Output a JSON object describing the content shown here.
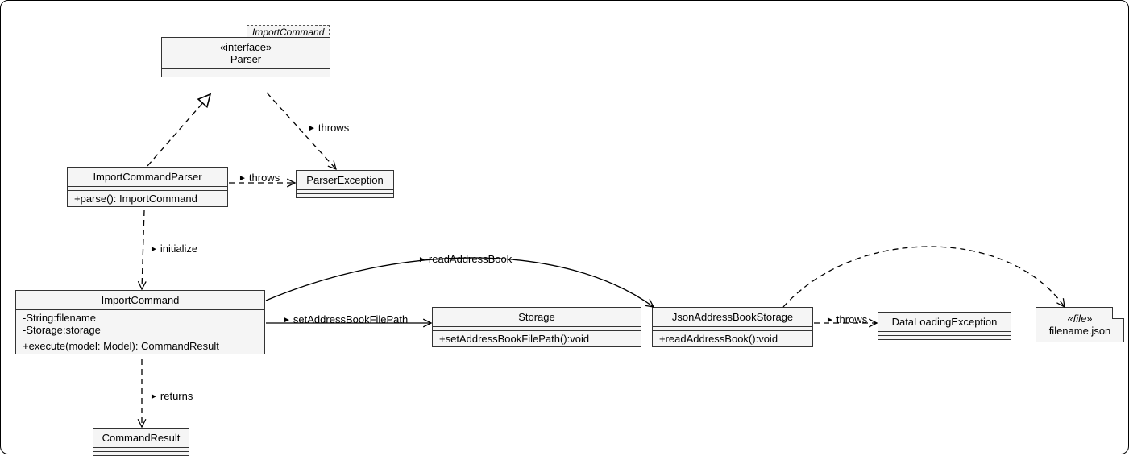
{
  "package_tab": "ImportCommand",
  "parser_interface": {
    "stereotype": "«interface»",
    "name": "Parser"
  },
  "import_command_parser": {
    "name": "ImportCommandParser",
    "method": "+parse(): ImportCommand"
  },
  "parser_exception": {
    "name": "ParserException"
  },
  "import_command": {
    "name": "ImportCommand",
    "attr1": "-String:filename",
    "attr2": "-Storage:storage",
    "method": "+execute(model: Model): CommandResult"
  },
  "storage": {
    "name": "Storage",
    "method": "+setAddressBookFilePath():void"
  },
  "json_storage": {
    "name": "JsonAddressBookStorage",
    "method": "+readAddressBook():void"
  },
  "data_loading_exception": {
    "name": "DataLoadingException"
  },
  "command_result": {
    "name": "CommandResult"
  },
  "file_note": {
    "stereotype": "«file»",
    "name": "filename.json"
  },
  "labels": {
    "throws_parser_interface": "throws",
    "throws_icp": "throws",
    "initialize": "initialize",
    "setAddressBookFilePath": "setAddressBookFilePath",
    "readAddressBook": "readAddressBook",
    "throws_json": "throws",
    "returns": "returns"
  },
  "chart_data": {
    "type": "uml-class-diagram",
    "package": "ImportCommand",
    "nodes": [
      {
        "id": "Parser",
        "kind": "interface",
        "name": "Parser",
        "stereotype": "«interface»"
      },
      {
        "id": "ImportCommandParser",
        "kind": "class",
        "name": "ImportCommandParser",
        "methods": [
          "+parse(): ImportCommand"
        ]
      },
      {
        "id": "ParserException",
        "kind": "class",
        "name": "ParserException"
      },
      {
        "id": "ImportCommand",
        "kind": "class",
        "name": "ImportCommand",
        "attributes": [
          "-String:filename",
          "-Storage:storage"
        ],
        "methods": [
          "+execute(model: Model): CommandResult"
        ]
      },
      {
        "id": "Storage",
        "kind": "class",
        "name": "Storage",
        "methods": [
          "+setAddressBookFilePath():void"
        ]
      },
      {
        "id": "JsonAddressBookStorage",
        "kind": "class",
        "name": "JsonAddressBookStorage",
        "methods": [
          "+readAddressBook():void"
        ]
      },
      {
        "id": "DataLoadingException",
        "kind": "class",
        "name": "DataLoadingException"
      },
      {
        "id": "CommandResult",
        "kind": "class",
        "name": "CommandResult"
      },
      {
        "id": "filename.json",
        "kind": "file",
        "name": "filename.json",
        "stereotype": "«file»"
      }
    ],
    "edges": [
      {
        "from": "ImportCommandParser",
        "to": "Parser",
        "kind": "realization",
        "style": "dashed-open-triangle"
      },
      {
        "from": "Parser",
        "to": "ParserException",
        "kind": "dependency",
        "label": "throws",
        "style": "dashed-open-arrow"
      },
      {
        "from": "ImportCommandParser",
        "to": "ParserException",
        "kind": "dependency",
        "label": "throws",
        "style": "dashed-open-arrow"
      },
      {
        "from": "ImportCommandParser",
        "to": "ImportCommand",
        "kind": "dependency",
        "label": "initialize",
        "style": "dashed-open-arrow"
      },
      {
        "from": "ImportCommand",
        "to": "Storage",
        "kind": "association",
        "label": "setAddressBookFilePath",
        "style": "solid-open-arrow"
      },
      {
        "from": "ImportCommand",
        "to": "JsonAddressBookStorage",
        "kind": "association",
        "label": "readAddressBook",
        "style": "solid-open-arrow"
      },
      {
        "from": "JsonAddressBookStorage",
        "to": "DataLoadingException",
        "kind": "dependency",
        "label": "throws",
        "style": "dashed-open-arrow"
      },
      {
        "from": "JsonAddressBookStorage",
        "to": "filename.json",
        "kind": "dependency",
        "style": "dashed-open-arrow"
      },
      {
        "from": "ImportCommand",
        "to": "CommandResult",
        "kind": "dependency",
        "label": "returns",
        "style": "dashed-open-arrow"
      }
    ]
  }
}
